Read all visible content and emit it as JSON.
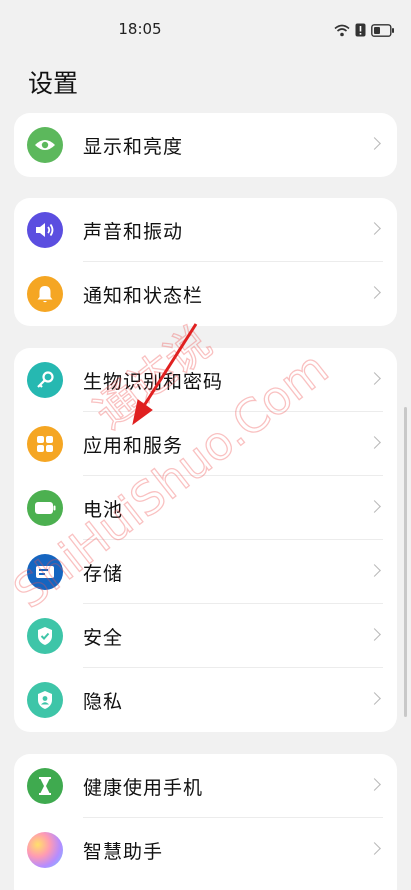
{
  "status_bar": {
    "time": "18:05",
    "icons": [
      "wifi-icon",
      "alert-icon",
      "battery-icon"
    ]
  },
  "page": {
    "title": "设置"
  },
  "groups": [
    {
      "items": [
        {
          "label": "显示和亮度",
          "icon": "eye-icon",
          "color": "#5cb85c"
        }
      ]
    },
    {
      "items": [
        {
          "label": "声音和振动",
          "icon": "speaker-icon",
          "color": "#5b4ee0"
        },
        {
          "label": "通知和状态栏",
          "icon": "bell-icon",
          "color": "#f5a623"
        }
      ]
    },
    {
      "items": [
        {
          "label": "生物识别和密码",
          "icon": "key-icon",
          "color": "#26b8b1"
        },
        {
          "label": "应用和服务",
          "icon": "apps-grid-icon",
          "color": "#f5a623"
        },
        {
          "label": "电池",
          "icon": "battery-icon",
          "color": "#4cb050"
        },
        {
          "label": "存储",
          "icon": "storage-icon",
          "color": "#1565c0"
        },
        {
          "label": "安全",
          "icon": "shield-check-icon",
          "color": "#3ec5a8"
        },
        {
          "label": "隐私",
          "icon": "privacy-shield-icon",
          "color": "#3ec5a8"
        }
      ]
    },
    {
      "items": [
        {
          "label": "健康使用手机",
          "icon": "hourglass-icon",
          "color": "#3faa4f"
        },
        {
          "label": "智慧助手",
          "icon": "assistant-orb-icon",
          "color": "#e07ab8"
        }
      ]
    }
  ],
  "watermark": {
    "text": "ShiHuiShuo.Com",
    "chinese": "通达说",
    "color": "#f05050"
  }
}
